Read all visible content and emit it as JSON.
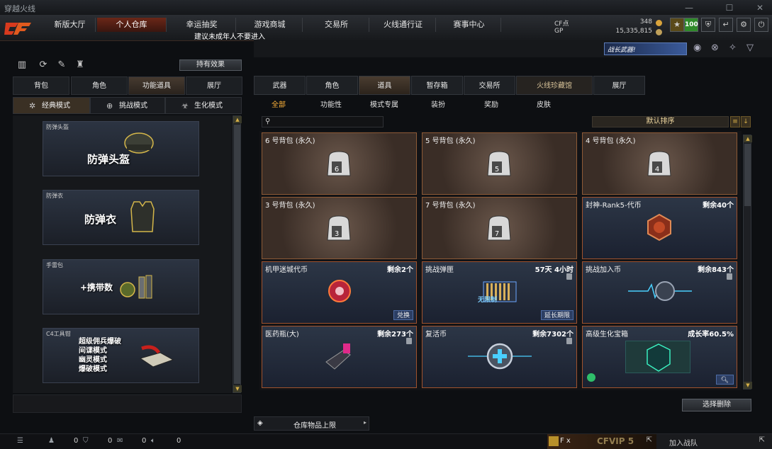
{
  "window": {
    "title": "穿越火线"
  },
  "topnav": {
    "tabs": [
      "新版大厅",
      "个人仓库",
      "幸运抽奖",
      "游戏商城",
      "交易所",
      "火线通行证",
      "赛事中心"
    ],
    "active_index": 1,
    "notice": "建议未成年人不要进入",
    "currency": {
      "cf_label": "CF点",
      "cf_value": "348",
      "gp_label": "GP",
      "gp_value": "15,335,815"
    },
    "level": "100"
  },
  "left": {
    "effect_button": "持有效果",
    "tabs": [
      "背包",
      "角色",
      "功能道具",
      "展厅"
    ],
    "active_tab": 2,
    "modes": [
      "经典模式",
      "挑战模式",
      "生化模式"
    ],
    "active_mode": 0,
    "cards": [
      {
        "tag": "防弹头盔",
        "name": "防弹头盔"
      },
      {
        "tag": "防弹衣",
        "name": "防弹衣"
      },
      {
        "tag": "手雷包",
        "name": "+携带数"
      },
      {
        "tag": "C4工具钳",
        "lines": [
          "超级佣兵爆破",
          "间谍模式",
          "幽灵模式",
          "爆破模式"
        ]
      }
    ]
  },
  "right": {
    "banner": "战长武器!",
    "tabs": [
      "武器",
      "角色",
      "道具",
      "暂存箱",
      "交易所",
      "火线珍藏馆",
      "展厅"
    ],
    "active_tab": 2,
    "subtabs": [
      "全部",
      "功能性",
      "模式专属",
      "装扮",
      "奖励",
      "皮肤"
    ],
    "active_subtab": 0,
    "search_placeholder": "",
    "sort_label": "默认排序",
    "items": [
      {
        "name": "6 号背包 (永久)",
        "bag": "6"
      },
      {
        "name": "5 号背包 (永久)",
        "bag": "5"
      },
      {
        "name": "4 号背包 (永久)",
        "bag": "4"
      },
      {
        "name": "3 号背包 (永久)",
        "bag": "3"
      },
      {
        "name": "7 号背包 (永久)",
        "bag": "7"
      },
      {
        "name": "封神-Rank5-代币",
        "remain": "剩余40个"
      },
      {
        "name": "机甲迷城代币",
        "remain": "剩余2个",
        "action": "兑换"
      },
      {
        "name": "挑战弹匣",
        "remain": "57天 4小时",
        "action": "延长期限",
        "pic_text": "无限制"
      },
      {
        "name": "挑战加入币",
        "remain": "剩余843个"
      },
      {
        "name": "医药瓶(大)",
        "remain": "剩余273个"
      },
      {
        "name": "复活币",
        "remain": "剩余7302个"
      },
      {
        "name": "高级生化宝箱",
        "remain": "成长率60.5%"
      }
    ],
    "select_delete": "选择删除",
    "warehouse_limit": "仓库物品上限"
  },
  "statusbar": {
    "counts": [
      "0",
      "0",
      "0",
      "0"
    ],
    "fx_label": "F x",
    "vip_text": "CFVIP 5",
    "join_team": "加入战队"
  },
  "colors": {
    "accent": "#ffb43a",
    "active_tab": "#6b2718",
    "item_border": "#a0522d"
  }
}
